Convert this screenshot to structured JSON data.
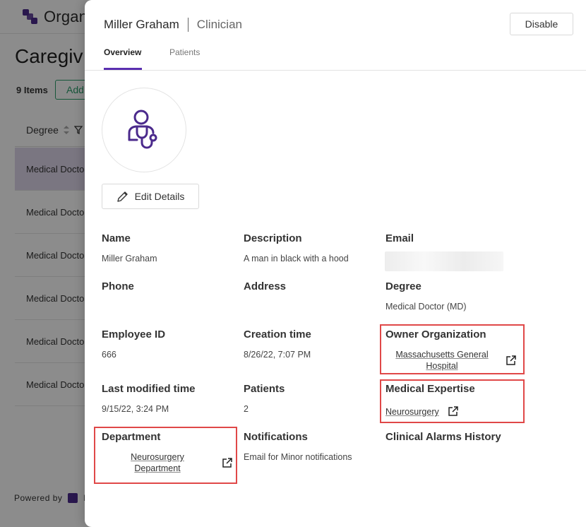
{
  "background": {
    "logo_text": "Organ",
    "page_title": "Caregiv",
    "items_count": "9 Items",
    "add_label": "Add",
    "column_header": "Degree",
    "rows": [
      "Medical Doctor",
      "Medical Doctor",
      "Medical Doctor",
      "Medical Doctor",
      "Medical Doctor",
      "Medical Doctor"
    ],
    "footer_text": "Powered by",
    "footer_brand_initial": "b"
  },
  "drawer": {
    "name": "Miller Graham",
    "role": "Clinician",
    "disable_label": "Disable",
    "tabs": [
      {
        "label": "Overview",
        "active": true
      },
      {
        "label": "Patients",
        "active": false
      }
    ],
    "edit_label": "Edit Details",
    "avatar_icon": "doctor-stethoscope-icon",
    "accent_color": "#5a2fb0"
  },
  "fields": {
    "name": {
      "label": "Name",
      "value": "Miller Graham"
    },
    "description": {
      "label": "Description",
      "value": "A man in black with a hood"
    },
    "email": {
      "label": "Email",
      "value": ""
    },
    "phone": {
      "label": "Phone",
      "value": ""
    },
    "address": {
      "label": "Address",
      "value": ""
    },
    "degree": {
      "label": "Degree",
      "value": "Medical Doctor (MD)"
    },
    "employee_id": {
      "label": "Employee ID",
      "value": "666"
    },
    "creation_time": {
      "label": "Creation time",
      "value": "8/26/22, 7:07 PM"
    },
    "owner_org": {
      "label": "Owner Organization",
      "value_line1": "Massachusetts General",
      "value_line2": "Hospital"
    },
    "last_modified": {
      "label": "Last modified time",
      "value": "9/15/22, 3:24 PM"
    },
    "patients": {
      "label": "Patients",
      "value": "2"
    },
    "medical_expertise": {
      "label": "Medical Expertise",
      "value": "Neurosurgery"
    },
    "department": {
      "label": "Department",
      "value_line1": "Neurosurgery",
      "value_line2": "Department"
    },
    "notifications": {
      "label": "Notifications",
      "value": "Email for Minor notifications"
    },
    "clinical_alarms": {
      "label": "Clinical Alarms History",
      "value": ""
    }
  },
  "highlight_color": "#e04848"
}
